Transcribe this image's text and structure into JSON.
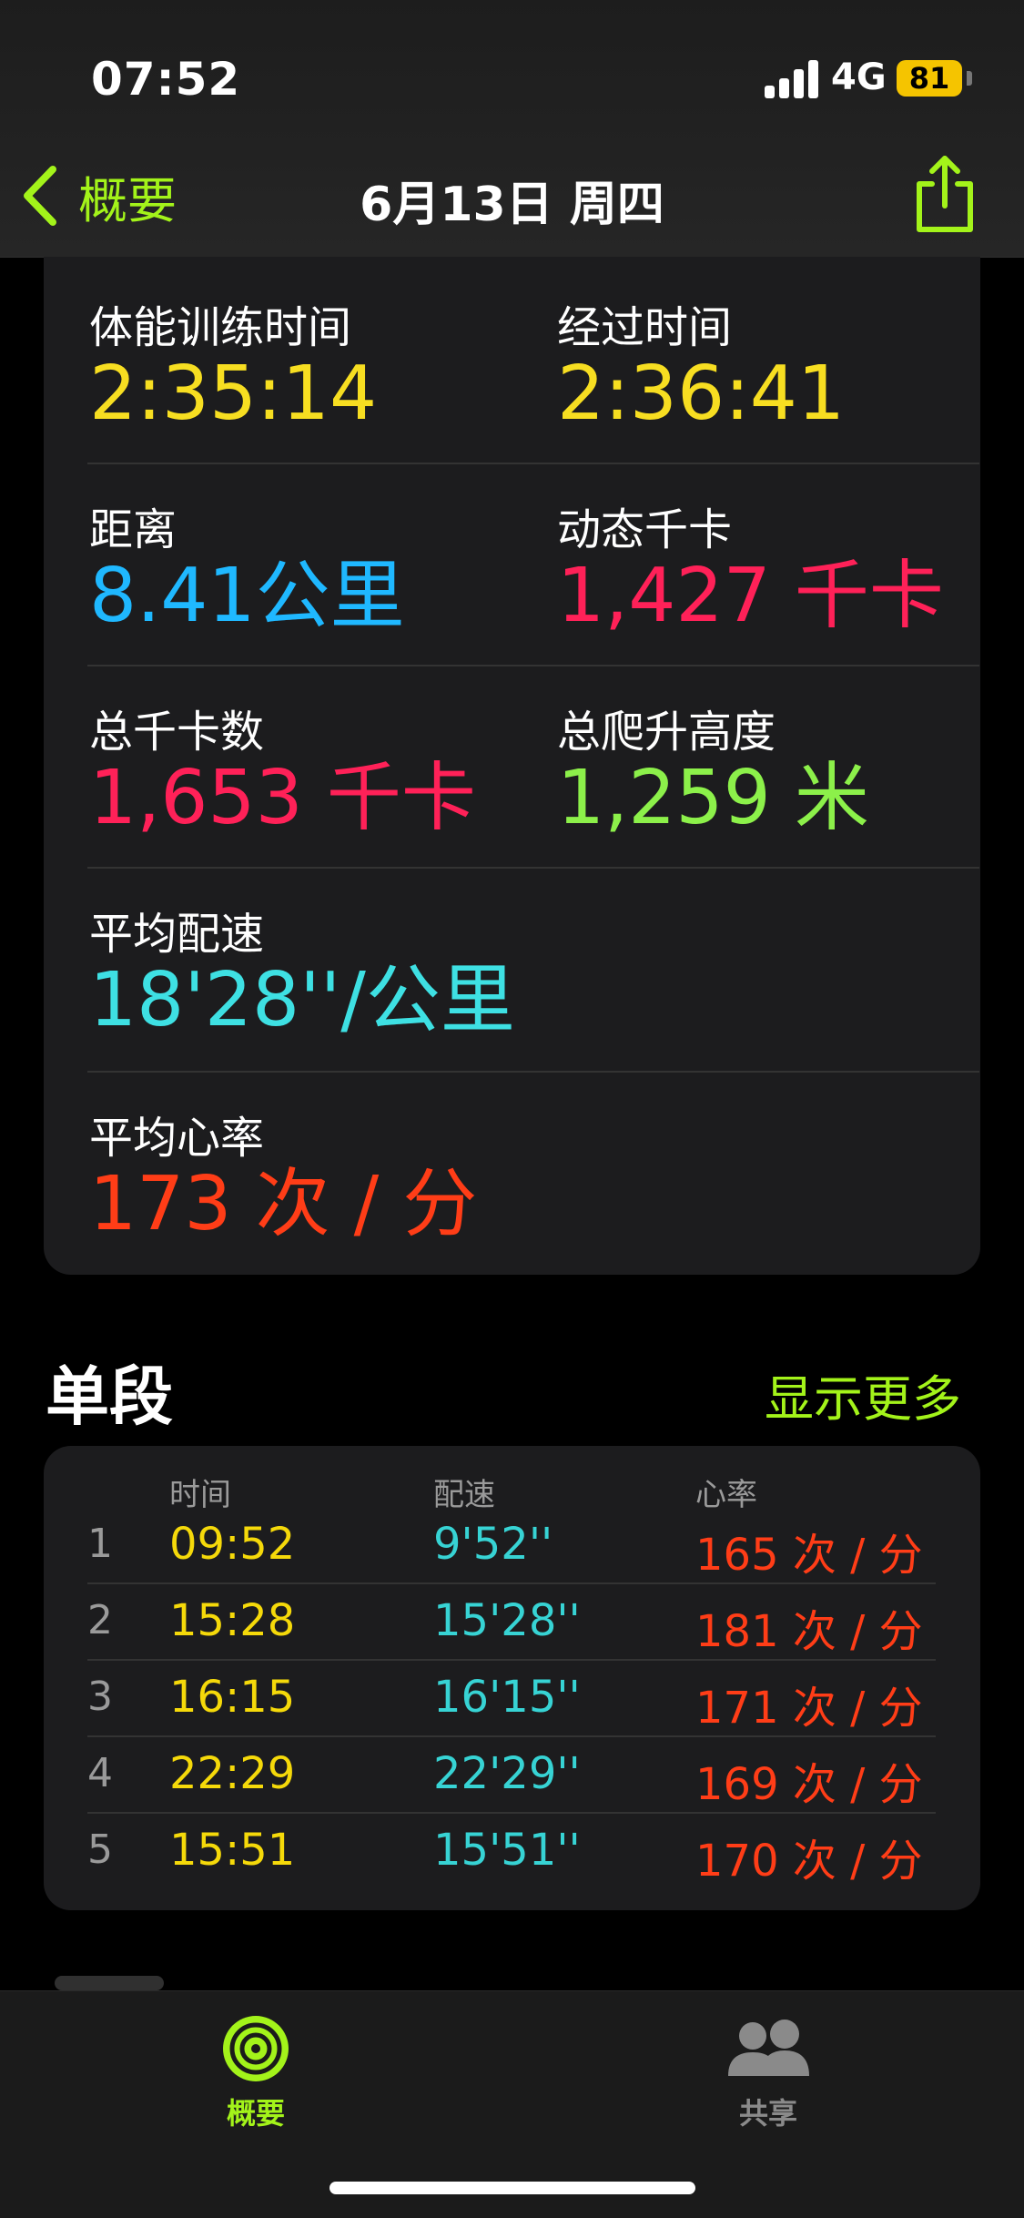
{
  "status_bar": {
    "time": "07:52",
    "network": "4G",
    "battery": "81"
  },
  "nav": {
    "back_label": "概要",
    "title": "6月13日 周四"
  },
  "stats": {
    "workout_time": {
      "label": "体能训练时间",
      "value": "2:35:14",
      "color": "#f7de21"
    },
    "elapsed_time": {
      "label": "经过时间",
      "value": "2:36:41",
      "color": "#f7de21"
    },
    "distance": {
      "label": "距离",
      "value": "8.41公里",
      "color": "#1fb8ff"
    },
    "active_calories": {
      "label": "动态千卡",
      "value": "1,427 千卡",
      "color": "#ff2158"
    },
    "total_calories": {
      "label": "总千卡数",
      "value": "1,653 千卡",
      "color": "#ff2158"
    },
    "elevation_gain": {
      "label": "总爬升高度",
      "value": "1,259 米",
      "color": "#8cf04a"
    },
    "avg_pace": {
      "label": "平均配速",
      "value": "18'28''/公里",
      "color": "#3ee0e3"
    },
    "avg_heart_rate": {
      "label": "平均心率",
      "value": "173 次 / 分",
      "color": "#ff3d17"
    }
  },
  "splits": {
    "title": "单段",
    "show_more": "显示更多",
    "headers": {
      "time": "时间",
      "pace": "配速",
      "heart_rate": "心率"
    },
    "rows": [
      {
        "index": "1",
        "time": "09:52",
        "pace": "9'52''",
        "heart_rate": "165 次 / 分"
      },
      {
        "index": "2",
        "time": "15:28",
        "pace": "15'28''",
        "heart_rate": "181 次 / 分"
      },
      {
        "index": "3",
        "time": "16:15",
        "pace": "16'15''",
        "heart_rate": "171 次 / 分"
      },
      {
        "index": "4",
        "time": "22:29",
        "pace": "22'29''",
        "heart_rate": "169 次 / 分"
      },
      {
        "index": "5",
        "time": "15:51",
        "pace": "15'51''",
        "heart_rate": "170 次 / 分"
      }
    ]
  },
  "tab_bar": {
    "tabs": [
      {
        "label": "概要",
        "icon": "activity-rings-icon",
        "selected": true
      },
      {
        "label": "共享",
        "icon": "people-icon",
        "selected": false
      }
    ]
  },
  "colors": {
    "accent": "#a3f31a",
    "background": "#000000",
    "card": "#1c1c1e"
  }
}
